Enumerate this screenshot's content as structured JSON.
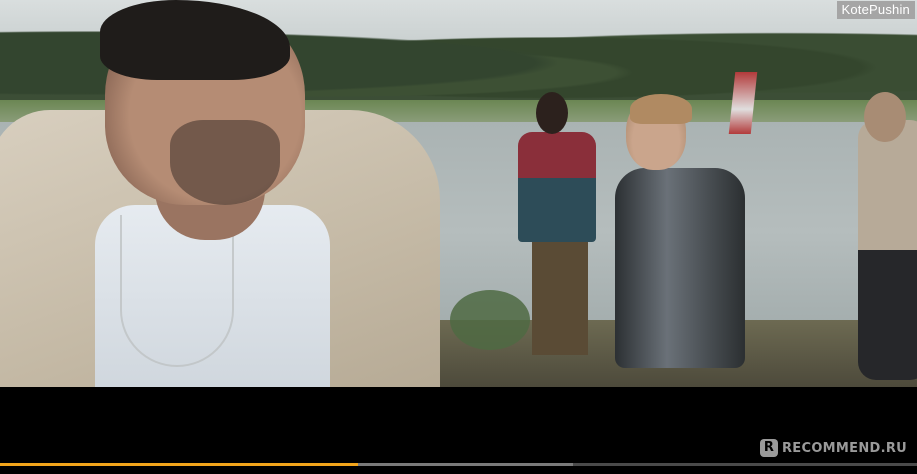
{
  "watermark": {
    "username": "KotePushin"
  },
  "player": {
    "progress": 0.39,
    "buffered": 0.625,
    "colors": {
      "progress_fill": "#f3a51b",
      "buffer": "#7a7a7a",
      "track": "#4a4a4a"
    }
  },
  "brand": {
    "icon_letter": "R",
    "text": "RECOMMEND.RU"
  }
}
